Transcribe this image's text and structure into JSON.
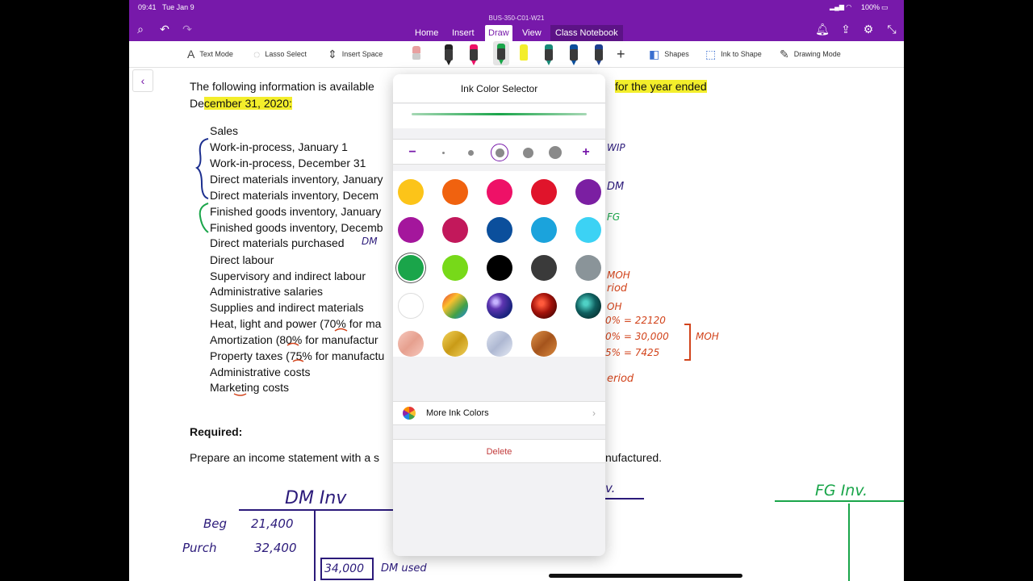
{
  "status": {
    "time": "09:41",
    "date": "Tue Jan 9",
    "battery": "100%"
  },
  "doc_title": "BUS-350-C01-W21",
  "tabs": [
    {
      "label": "Home"
    },
    {
      "label": "Insert"
    },
    {
      "label": "Draw"
    },
    {
      "label": "View"
    },
    {
      "label": "Class Notebook"
    }
  ],
  "ribbon": {
    "text_mode": "Text Mode",
    "lasso_select": "Lasso Select",
    "insert_space": "Insert Space",
    "shapes": "Shapes",
    "ink_to_shape": "Ink to Shape",
    "drawing_mode": "Drawing Mode"
  },
  "page": {
    "intro_line1_a": "The following information is available",
    "intro_line1_b": "for the year ended",
    "intro_line2_a": "De",
    "intro_line2_b": "cember 31, 2020:",
    "items": [
      "Sales",
      "Work-in-process, January 1",
      "Work-in-process, December 31",
      "Direct materials inventory, January",
      "Direct materials inventory, Decem",
      "Finished goods inventory, January",
      "Finished goods inventory, Decemb",
      "Direct materials purchased",
      "Direct labour",
      "Supervisory and indirect labour",
      "Administrative salaries",
      "Supplies and indirect materials",
      "Heat, light and power (70% for ma",
      "Amortization (80% for manufactur",
      "Property taxes (75% for manufactu",
      "Administrative costs",
      "Marketing costs"
    ],
    "required": "Required:",
    "prepare_a": "Prepare an income statement with a s",
    "prepare_b": "nufactured."
  },
  "handwriting": {
    "dm_purchased": "DM",
    "wip": "WIP",
    "dm": "DM",
    "fg": "FG",
    "moh1": "MOH",
    "period1": "riod",
    "moh2": "OH",
    "calc1": "0% = 22120",
    "calc2": "0% = 30,000",
    "calc3": "5% = 7425",
    "moh3": "MOH",
    "period2": "eriod",
    "dm_inv": "DM Inv",
    "fg_inv": "FG Inv.",
    "beg": "Beg",
    "beg_val": "21,400",
    "purch": "Purch",
    "purch_val": "32,400",
    "boxed": "34,000",
    "dm_used": "DM used",
    "mid_inv": "v."
  },
  "popover": {
    "title": "Ink Color Selector",
    "minus": "−",
    "plus": "+",
    "selected_color": "#1aa54a",
    "swatches": [
      [
        "#fcc419",
        "#f0620f",
        "#ee1167",
        "#e0142b",
        "#7b1fa2"
      ],
      [
        "#a4169c",
        "#c2185b",
        "#0b4f9c",
        "#1ba3dc",
        "#3cd2f4"
      ],
      [
        "#1aa54a",
        "#77d919",
        "#000000",
        "#3a3a3a",
        "#8a9499"
      ],
      [
        "#ffffff",
        "rainbow",
        "galaxy",
        "lava",
        "ocean"
      ],
      [
        "rosegold",
        "gold",
        "silver",
        "bronze"
      ]
    ],
    "more_colors": "More Ink Colors",
    "delete": "Delete"
  }
}
